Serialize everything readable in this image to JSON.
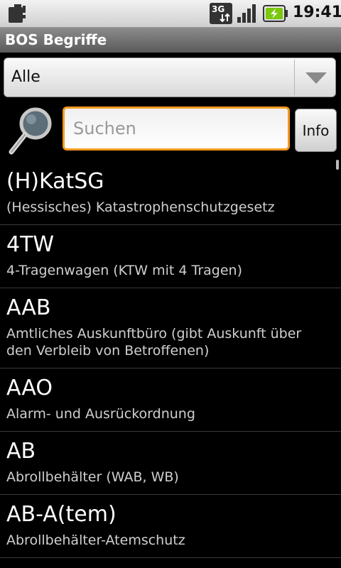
{
  "status_bar": {
    "time": "19:41",
    "network_label": "3G",
    "icons": [
      "sd-card-icon",
      "network-3g-icon",
      "signal-icon",
      "battery-charging-icon"
    ]
  },
  "app": {
    "title": "BOS Begriffe"
  },
  "filter": {
    "selected": "Alle"
  },
  "search": {
    "placeholder": "Suchen",
    "value": ""
  },
  "info_button": {
    "label": "Info"
  },
  "colors": {
    "accent": "#f39a1e",
    "background": "#000000"
  },
  "list": {
    "items": [
      {
        "term": "(H)KatSG",
        "description": "(Hessisches) Katastrophenschutzgesetz"
      },
      {
        "term": "4TW",
        "description": "4-Tragenwagen (KTW mit 4 Tragen)"
      },
      {
        "term": "AAB",
        "description": "Amtliches Auskunftbüro (gibt Auskunft über den Verbleib von Betroffenen)"
      },
      {
        "term": "AAO",
        "description": "Alarm- und Ausrückordnung"
      },
      {
        "term": "AB",
        "description": "Abrollbehälter (WAB, WB)"
      },
      {
        "term": "AB-A(tem)",
        "description": "Abrollbehälter-Atemschutz"
      }
    ]
  }
}
